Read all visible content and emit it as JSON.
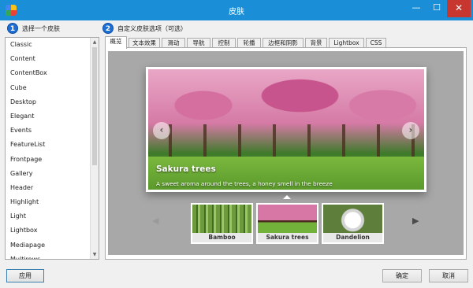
{
  "window": {
    "title": "皮肤",
    "minimize": "—",
    "maximize": "☐",
    "close": "✕"
  },
  "step1": {
    "number": "1",
    "label": "选择一个皮肤"
  },
  "step2": {
    "number": "2",
    "label": "自定义皮肤选项（可选）"
  },
  "skins": [
    "Classic",
    "Content",
    "ContentBox",
    "Cube",
    "Desktop",
    "Elegant",
    "Events",
    "FeatureList",
    "Frontpage",
    "Gallery",
    "Header",
    "Highlight",
    "Light",
    "Lightbox",
    "Mediapage",
    "Multirows"
  ],
  "tabs": [
    "概览",
    "文本效果",
    "滑动",
    "导航",
    "控制",
    "轮播",
    "边框和阴影",
    "背景",
    "Lightbox",
    "CSS"
  ],
  "active_tab": "概览",
  "preview": {
    "slide_title": "Sakura trees",
    "slide_caption": "A sweet aroma around the trees, a honey smell in the breeze",
    "thumbnails": [
      "Bamboo",
      "Sakura trees",
      "Dandelion"
    ]
  },
  "buttons": {
    "apply": "应用",
    "ok": "确定",
    "cancel": "取消"
  },
  "colors": {
    "titlebar": "#1a8fd8",
    "step_badge": "#1d6fd3",
    "preview_bg": "#a8a8a8"
  }
}
